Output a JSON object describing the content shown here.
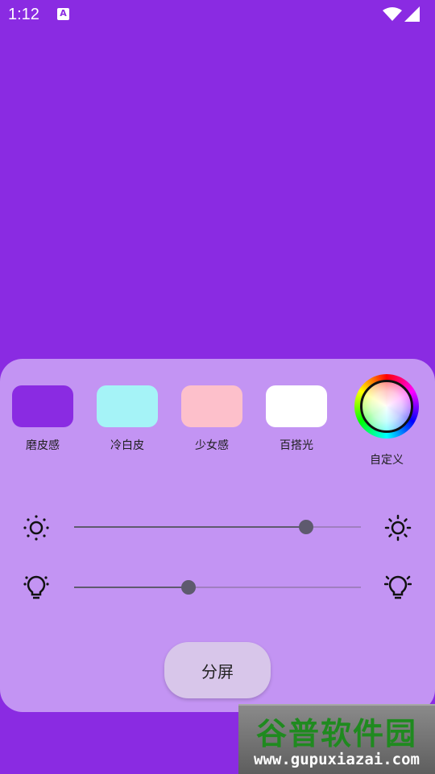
{
  "status_bar": {
    "time": "1:12",
    "notification_icon": "a-text-icon",
    "notification_glyph": "A",
    "wifi_icon": "wifi-icon",
    "signal_icon": "cell-signal-icon"
  },
  "colors": {
    "background": "#8a2be2",
    "panel": "#c394f3",
    "slider": "#5e5a6e"
  },
  "presets": [
    {
      "label": "磨皮感",
      "color": "#8a2be2"
    },
    {
      "label": "冷白皮",
      "color": "#a5f3f7"
    },
    {
      "label": "少女感",
      "color": "#fdc0cb"
    },
    {
      "label": "百搭光",
      "color": "#ffffff"
    }
  ],
  "custom": {
    "label": "自定义",
    "icon": "color-wheel-icon"
  },
  "sliders": {
    "brightness": {
      "icon_low": "brightness-low-icon",
      "icon_high": "brightness-high-icon",
      "value": 0.81
    },
    "warmth": {
      "icon_low": "lightbulb-dim-icon",
      "icon_high": "lightbulb-bright-icon",
      "value": 0.4
    }
  },
  "split_button": {
    "label": "分屏"
  },
  "watermark": {
    "brand": "谷普软件园",
    "url": "www.gupuxiazai.com"
  }
}
